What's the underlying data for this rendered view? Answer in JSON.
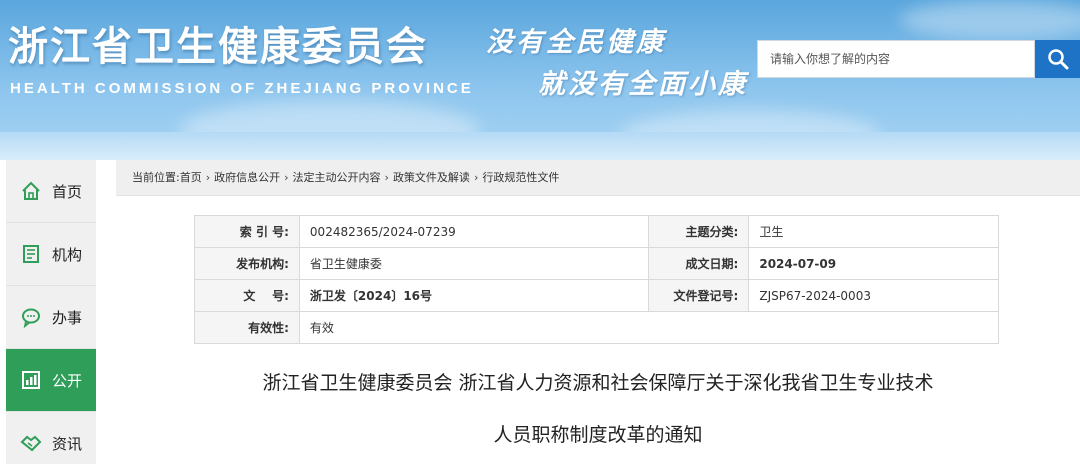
{
  "header": {
    "title": "浙江省卫生健康委员会",
    "subtitle": "HEALTH COMMISSION OF ZHEJIANG PROVINCE",
    "slogan_line1": "没有全民健康",
    "slogan_line2": "就没有全面小康",
    "search_placeholder": "请输入你想了解的内容",
    "search_icon": "search-icon"
  },
  "sidebar": {
    "items": [
      {
        "label": "首页",
        "icon": "home-icon"
      },
      {
        "label": "机构",
        "icon": "building-icon"
      },
      {
        "label": "办事",
        "icon": "chat-icon"
      },
      {
        "label": "公开",
        "icon": "chart-icon"
      },
      {
        "label": "资讯",
        "icon": "handshake-icon"
      }
    ],
    "active_color": "#2e9e58"
  },
  "breadcrumb": {
    "prefix": "当前位置:",
    "items": [
      "首页",
      "政府信息公开",
      "法定主动公开内容",
      "政策文件及解读",
      "行政规范性文件"
    ],
    "separator": "›"
  },
  "info": {
    "index_label": "索 引 号:",
    "index_value": "002482365/2024-07239",
    "category_label": "主题分类:",
    "category_value": "卫生",
    "issuer_label": "发布机构:",
    "issuer_value": "省卫生健康委",
    "date_label": "成文日期:",
    "date_value": "2024-07-09",
    "docno_label": "文    号:",
    "docno_value": "浙卫发〔2024〕16号",
    "regno_label": "文件登记号:",
    "regno_value": "ZJSP67-2024-0003",
    "validity_label": "有效性:",
    "validity_value": "有效"
  },
  "document": {
    "title_line1": "浙江省卫生健康委员会 浙江省人力资源和社会保障厅关于深化我省卫生专业技术",
    "title_line2": "人员职称制度改革的通知"
  },
  "colors": {
    "header_blue": "#5aa6dd",
    "search_button": "#1f73c7",
    "sidebar_bg": "#f0f0f0",
    "accent_green": "#2e9e58"
  }
}
